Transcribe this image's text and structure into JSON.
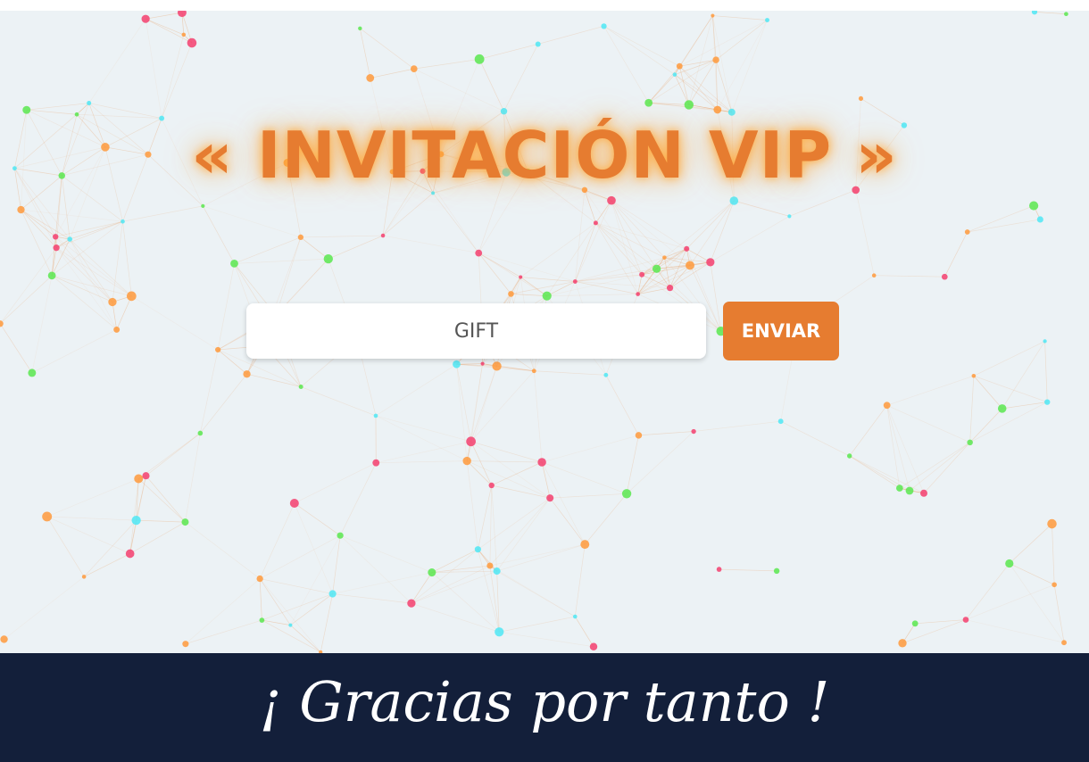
{
  "hero": {
    "title": "« INVITACIÓN VIP »"
  },
  "form": {
    "code_value": "GIFT",
    "submit_label": "ENVIAR"
  },
  "footer": {
    "message": "¡ Gracias por tanto !"
  },
  "colors": {
    "accent": "#e67c30",
    "background": "#ecf2f5",
    "footer_bg": "#131f3a",
    "dot_colors": [
      "#ff9a3c",
      "#4fe8f5",
      "#5be84f",
      "#f5406e"
    ]
  }
}
